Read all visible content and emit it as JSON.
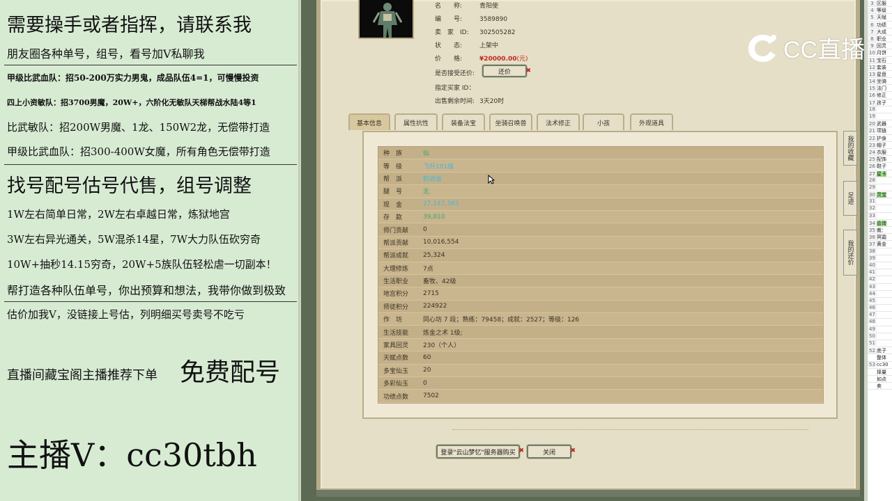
{
  "left_panel": {
    "lines": [
      "需要操手或者指挥，请联系我",
      "朋友圈各种单号，组号，看号加V私聊我",
      "甲级比武血队：招50-200万实力男鬼，成品队伍4=1，可慢慢投资",
      "四上小资敏队：招3700男魔，20W+，六阶化无敏队天梯帮战水陆4等1",
      "比武敏队：招200W男魔、1龙、150W2龙，无偿带打造",
      "甲级比武血队：招300-400W女魔，所有角色无偿带打造",
      "找号配号估号代售，组号调整",
      "1W左右简单日常，2W左右卓越日常，炼狱地宫",
      "3W左右异光通关，5W混杀14星，7W大力队伍砍穷奇",
      "10W+抽秒14.15穷奇，20W+5族队伍轻松虐一切副本！",
      "帮打造各种队伍单号，你出预算和想法，我带你做到极致",
      "估价加我V，没链接上号估，列明细买号卖号不吃亏",
      "直播间藏宝阁主播推荐下单",
      "免费配号",
      "主播V：cc30tbh"
    ]
  },
  "listing": {
    "rows": [
      {
        "key": "名　　称:",
        "value": "青阳使"
      },
      {
        "key": "编　　号:",
        "value": "3589890"
      },
      {
        "key": "卖　家　ID:",
        "value": "302505282"
      },
      {
        "key": "状　　态:",
        "value": "上架中"
      },
      {
        "key": "价　　格:",
        "value": "¥20000.00",
        "unit": "(元)"
      },
      {
        "key": "是否接受还价:",
        "value": ""
      },
      {
        "key": "指定买家 ID：",
        "value": ""
      },
      {
        "key": "出售剩余时间:",
        "value": "3天20时"
      }
    ],
    "counter_offer_button": "还价"
  },
  "tabs": [
    "基本信息",
    "属性抗性",
    "装备法宝",
    "坐骑召唤兽",
    "法术修正",
    "小孩",
    "外观道具"
  ],
  "active_tab": 0,
  "attributes": [
    {
      "key": "种　族",
      "value": "仙",
      "style": "green"
    },
    {
      "key": "等　级",
      "value": "飞升181级",
      "style": "cyan"
    },
    {
      "key": "帮　派",
      "value": "韵逍遥",
      "style": "cyan"
    },
    {
      "key": "腿　号",
      "value": "无",
      "style": "green"
    },
    {
      "key": "现　金",
      "value": "27,147,383",
      "style": "cyan"
    },
    {
      "key": "存　款",
      "value": "39,810",
      "style": "green"
    },
    {
      "key": "师门贡献",
      "value": "0",
      "style": ""
    },
    {
      "key": "帮派贡献",
      "value": "10,016,554",
      "style": ""
    },
    {
      "key": "帮派成就",
      "value": "25,324",
      "style": ""
    },
    {
      "key": "大理修炼",
      "value": "7点",
      "style": ""
    },
    {
      "key": "生活职业",
      "value": "畜牧、42级",
      "style": ""
    },
    {
      "key": "地宫积分",
      "value": "2715",
      "style": ""
    },
    {
      "key": "师徒积分",
      "value": "224922",
      "style": ""
    },
    {
      "key": "作　坊",
      "value": "同心坊 7 段；熟练：79458；成就：2527；等级：126",
      "style": ""
    },
    {
      "key": "生活技能",
      "value": "炼金之术 1级;",
      "style": ""
    },
    {
      "key": "家具回灵",
      "value": "230（个人）",
      "style": ""
    },
    {
      "key": "天赋点数",
      "value": "60",
      "style": ""
    },
    {
      "key": "多宝仙玉",
      "value": "20",
      "style": ""
    },
    {
      "key": "多彩仙玉",
      "value": "0",
      "style": ""
    },
    {
      "key": "功绩点数",
      "value": "7502",
      "style": ""
    }
  ],
  "footer": {
    "login_buy_button": "登录\"云山梦忆\"服务器购买",
    "close_button": "关闭"
  },
  "side_tabs": [
    "我的收藏",
    "足迹",
    "我的还价"
  ],
  "sheet": {
    "rows": [
      {
        "n": "3",
        "t": "区服"
      },
      {
        "n": "4",
        "t": "等级"
      },
      {
        "n": "5",
        "t": "天赋"
      },
      {
        "n": "6",
        "t": "功绩"
      },
      {
        "n": "7",
        "t": "大成"
      },
      {
        "n": "8",
        "t": "职业"
      },
      {
        "n": "9",
        "t": "回灵"
      },
      {
        "n": "10",
        "t": "月饼"
      },
      {
        "n": "11",
        "t": "宝石"
      },
      {
        "n": "12",
        "t": "套装"
      },
      {
        "n": "13",
        "t": "星盘"
      },
      {
        "n": "14",
        "t": "坐骑"
      },
      {
        "n": "15",
        "t": "法门"
      },
      {
        "n": "16",
        "t": "修正"
      },
      {
        "n": "17",
        "t": "孩子"
      },
      {
        "n": "18",
        "t": ""
      },
      {
        "n": "19",
        "t": ""
      },
      {
        "n": "20",
        "t": "武器"
      },
      {
        "n": "21",
        "t": "项链"
      },
      {
        "n": "22",
        "t": "护身"
      },
      {
        "n": "23",
        "t": "帽子"
      },
      {
        "n": "24",
        "t": "衣服"
      },
      {
        "n": "25",
        "t": "配饰"
      },
      {
        "n": "26",
        "t": "鞋子"
      },
      {
        "n": "27",
        "t": "星卡",
        "hl": true
      },
      {
        "n": "28",
        "t": ""
      },
      {
        "n": "29",
        "t": ""
      },
      {
        "n": "30",
        "t": "灵宝",
        "hl": true
      },
      {
        "n": "31",
        "t": ""
      },
      {
        "n": "32",
        "t": ""
      },
      {
        "n": "33",
        "t": ""
      },
      {
        "n": "34",
        "t": "会询",
        "hl": true
      },
      {
        "n": "35",
        "t": "裁："
      },
      {
        "n": "36",
        "t": "冥霜"
      },
      {
        "n": "37",
        "t": "黄金"
      },
      {
        "n": "38",
        "t": ""
      },
      {
        "n": "39",
        "t": ""
      },
      {
        "n": "40",
        "t": ""
      },
      {
        "n": "41",
        "t": ""
      },
      {
        "n": "42",
        "t": ""
      },
      {
        "n": "43",
        "t": ""
      },
      {
        "n": "44",
        "t": ""
      },
      {
        "n": "45",
        "t": ""
      },
      {
        "n": "46",
        "t": ""
      },
      {
        "n": "47",
        "t": ""
      },
      {
        "n": "48",
        "t": ""
      },
      {
        "n": "49",
        "t": ""
      },
      {
        "n": "50",
        "t": ""
      },
      {
        "n": "51",
        "t": ""
      },
      {
        "n": "52",
        "t": "底子"
      },
      {
        "n": "",
        "t": "整体"
      },
      {
        "n": "53",
        "t": "cc30"
      },
      {
        "n": "",
        "t": "择量"
      },
      {
        "n": "",
        "t": "如点"
      },
      {
        "n": "",
        "t": "卖"
      }
    ]
  },
  "watermark": {
    "text": "CC直播"
  },
  "colors": {
    "left_bg": "#d7ebd3",
    "game_bg": "#e6dfc8",
    "table_bg": "#c9b58e",
    "price_red": "#c0271d",
    "value_green": "#3aa96a",
    "value_cyan": "#4bb5d2"
  }
}
